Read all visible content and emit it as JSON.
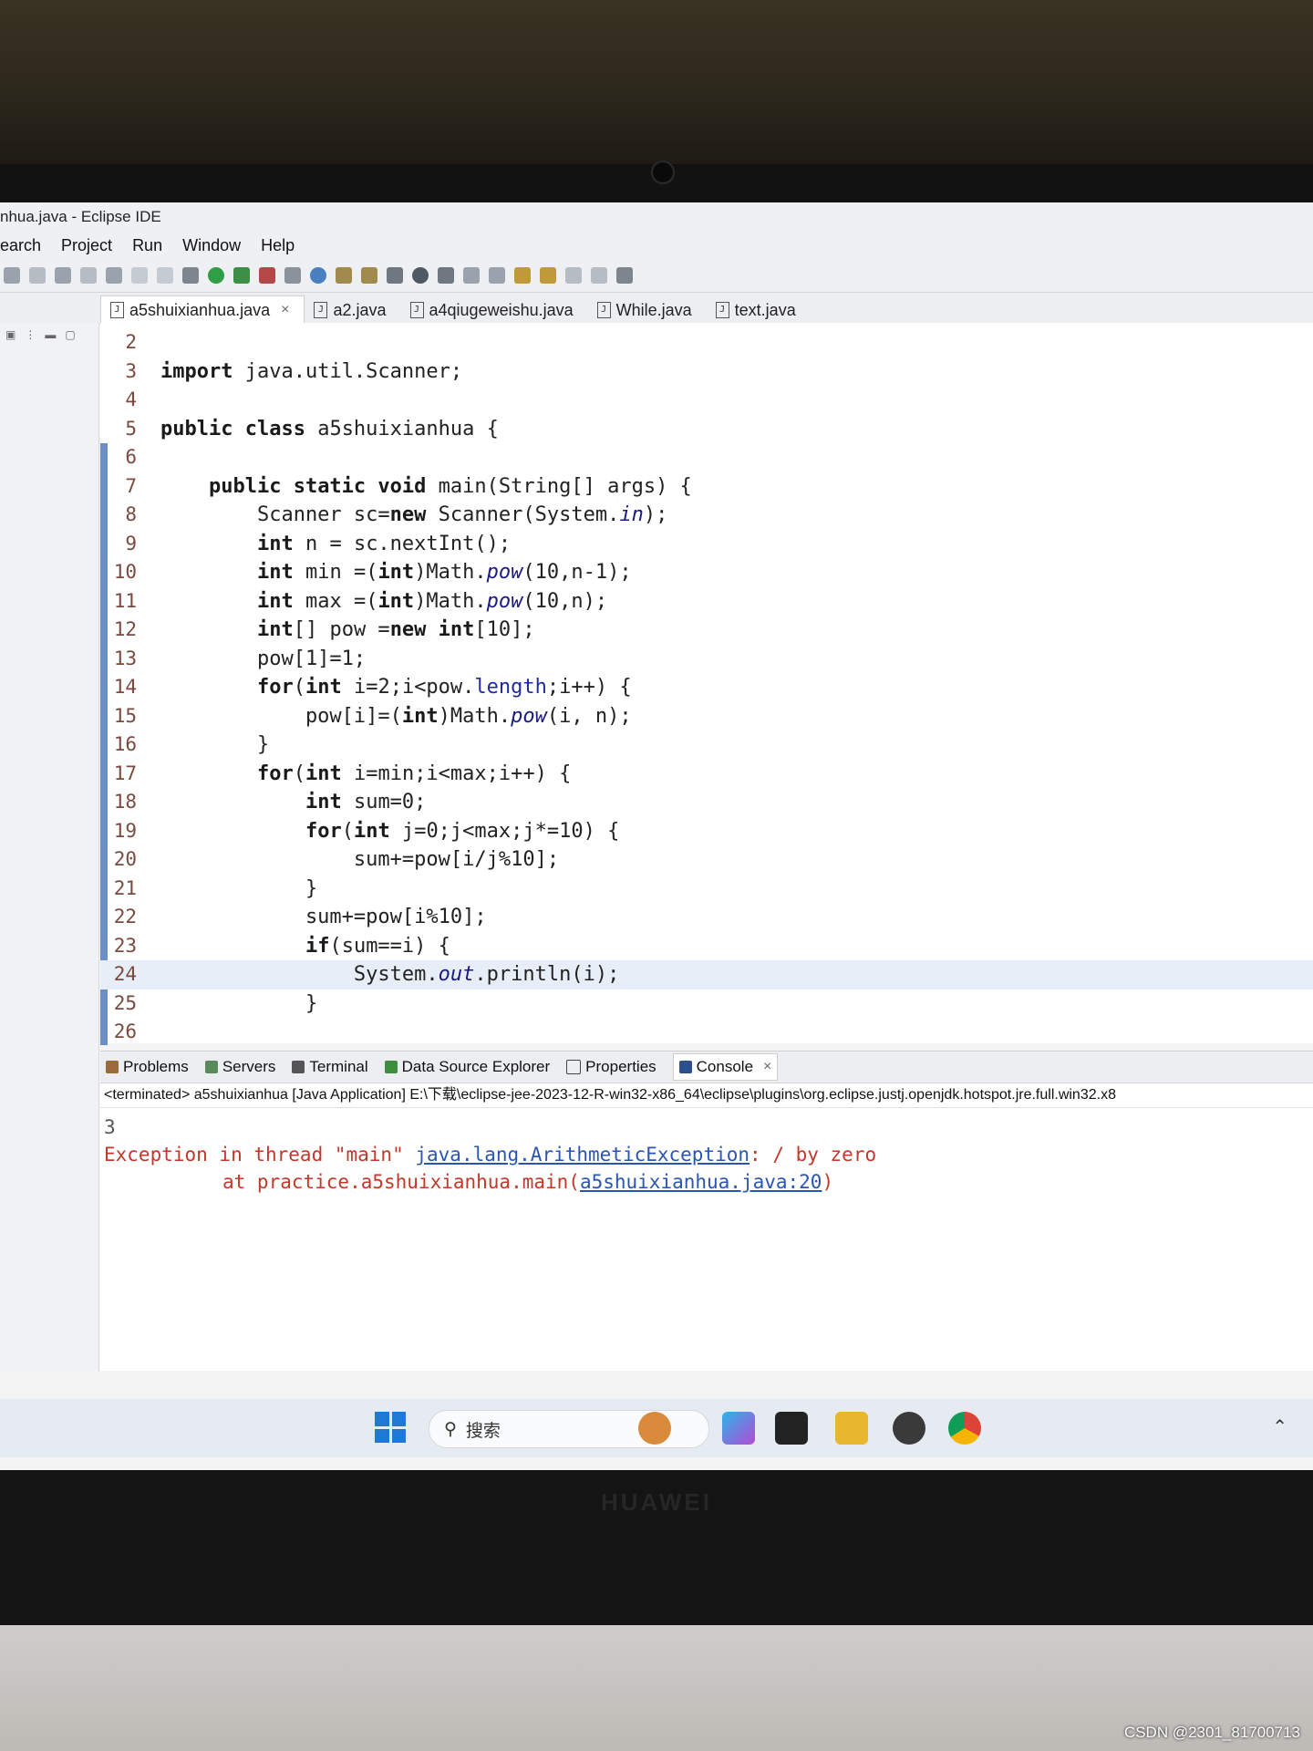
{
  "window": {
    "title": "nhua.java - Eclipse IDE"
  },
  "menu": [
    "earch",
    "Project",
    "Run",
    "Window",
    "Help"
  ],
  "editor_tabs": [
    {
      "label": "a5shuixianhua.java",
      "active": true
    },
    {
      "label": "a2.java",
      "active": false
    },
    {
      "label": "a4qiugeweishu.java",
      "active": false
    },
    {
      "label": "While.java",
      "active": false
    },
    {
      "label": "text.java",
      "active": false
    }
  ],
  "code_lines": [
    {
      "n": "2",
      "html": ""
    },
    {
      "n": "3",
      "html": "<span class='kw'>import</span> java.util.Scanner;"
    },
    {
      "n": "4",
      "html": ""
    },
    {
      "n": "5",
      "html": "<span class='kw'>public class</span> a5shuixianhua {"
    },
    {
      "n": "6",
      "html": ""
    },
    {
      "n": "7",
      "html": "    <span class='kw'>public static void</span> main(String[] args) {"
    },
    {
      "n": "8",
      "html": "        Scanner sc=<span class='kw'>new</span> Scanner(System.<span class='it'>in</span>);"
    },
    {
      "n": "9",
      "html": "        <span class='kw'>int</span> n = sc.nextInt();"
    },
    {
      "n": "10",
      "html": "        <span class='kw'>int</span> min =(<span class='kw'>int</span>)Math.<span class='it'>pow</span>(10,n-1);"
    },
    {
      "n": "11",
      "html": "        <span class='kw'>int</span> max =(<span class='kw'>int</span>)Math.<span class='it'>pow</span>(10,n);"
    },
    {
      "n": "12",
      "html": "        <span class='kw'>int</span>[] pow =<span class='kw'>new int</span>[10];"
    },
    {
      "n": "13",
      "html": "        pow[1]=1;"
    },
    {
      "n": "14",
      "html": "        <span class='kw'>for</span>(<span class='kw'>int</span> i=2;i&lt;pow.<span class='fld'>length</span>;i++) {"
    },
    {
      "n": "15",
      "html": "            pow[i]=(<span class='kw'>int</span>)Math.<span class='it'>pow</span>(i, n);"
    },
    {
      "n": "16",
      "html": "        }"
    },
    {
      "n": "17",
      "html": "        <span class='kw'>for</span>(<span class='kw'>int</span> i=min;i&lt;max;i++) {"
    },
    {
      "n": "18",
      "html": "            <span class='kw'>int</span> sum=0;"
    },
    {
      "n": "19",
      "html": "            <span class='kw'>for</span>(<span class='kw'>int</span> j=0;j&lt;max;j*=10) {"
    },
    {
      "n": "20",
      "html": "                sum+=pow[i/j%10];"
    },
    {
      "n": "21",
      "html": "            }"
    },
    {
      "n": "22",
      "html": "            sum+=pow[i%10];"
    },
    {
      "n": "23",
      "html": "            <span class='kw'>if</span>(sum==i) {"
    },
    {
      "n": "24",
      "html": "                System.<span class='it'>out</span>.println(i);"
    },
    {
      "n": "25",
      "html": "            }"
    },
    {
      "n": "26",
      "html": ""
    }
  ],
  "highlighted_line": "24",
  "panel_tabs": [
    {
      "label": "Problems",
      "active": false
    },
    {
      "label": "Servers",
      "active": false
    },
    {
      "label": "Terminal",
      "active": false
    },
    {
      "label": "Data Source Explorer",
      "active": false
    },
    {
      "label": "Properties",
      "active": false
    },
    {
      "label": "Console",
      "active": true
    }
  ],
  "console": {
    "status": "<terminated> a5shuixianhua [Java Application] E:\\下载\\eclipse-jee-2023-12-R-win32-x86_64\\eclipse\\plugins\\org.eclipse.justj.openjdk.hotspot.jre.full.win32.x8",
    "output": "3",
    "error_prefix": "Exception in thread \"main\" ",
    "error_class": "java.lang.ArithmeticException",
    "error_message": ": / by zero",
    "trace_prefix": "at practice.a5shuixianhua.main(",
    "trace_link": "a5shuixianhua.java:20",
    "trace_suffix": ")"
  },
  "taskbar": {
    "search_label": "搜索"
  },
  "device": {
    "brand": "HUAWEI"
  },
  "watermark": "CSDN @2301_81700713",
  "colors": {
    "keyword": "#1a1a1a",
    "line_number": "#7a4a3e",
    "error": "#c0392b",
    "link": "#2a55b0",
    "accent": "#1e78d6"
  }
}
